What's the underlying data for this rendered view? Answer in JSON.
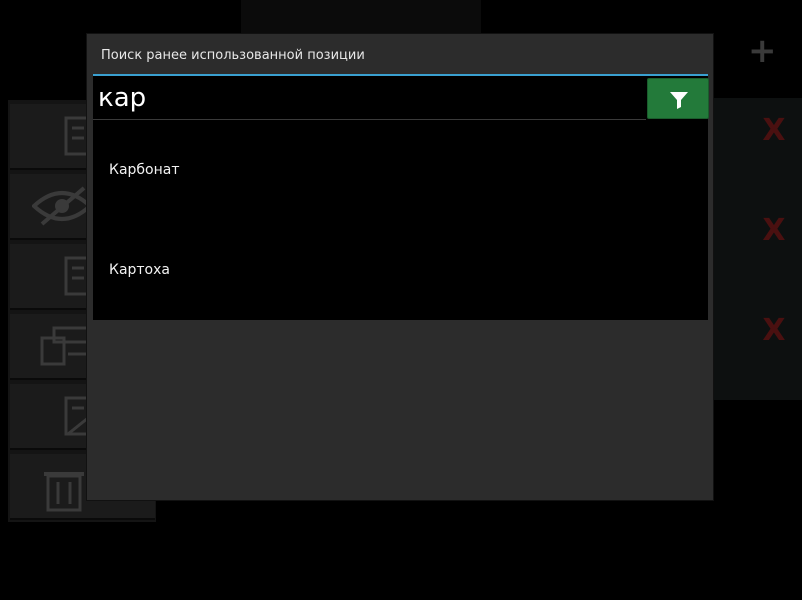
{
  "dialog": {
    "title": "Поиск ранее использованной позиции",
    "search": {
      "value": "кар",
      "placeholder": ""
    },
    "filter_icon": "filter-icon",
    "results": [
      {
        "label": "Карбонат"
      },
      {
        "label": "Картоха"
      }
    ]
  },
  "background": {
    "plus_label": "+",
    "delete_glyph": "X",
    "side_icons": [
      "checklist-icon",
      "eye-off-icon",
      "checklist-icon",
      "form-icon",
      "checklist-edit-icon",
      "trash-icon"
    ]
  },
  "colors": {
    "accent": "#3aa0d0",
    "filter_button": "#237a3a",
    "dialog_bg": "#2c2c2c",
    "delete_x": "#4a1010"
  }
}
